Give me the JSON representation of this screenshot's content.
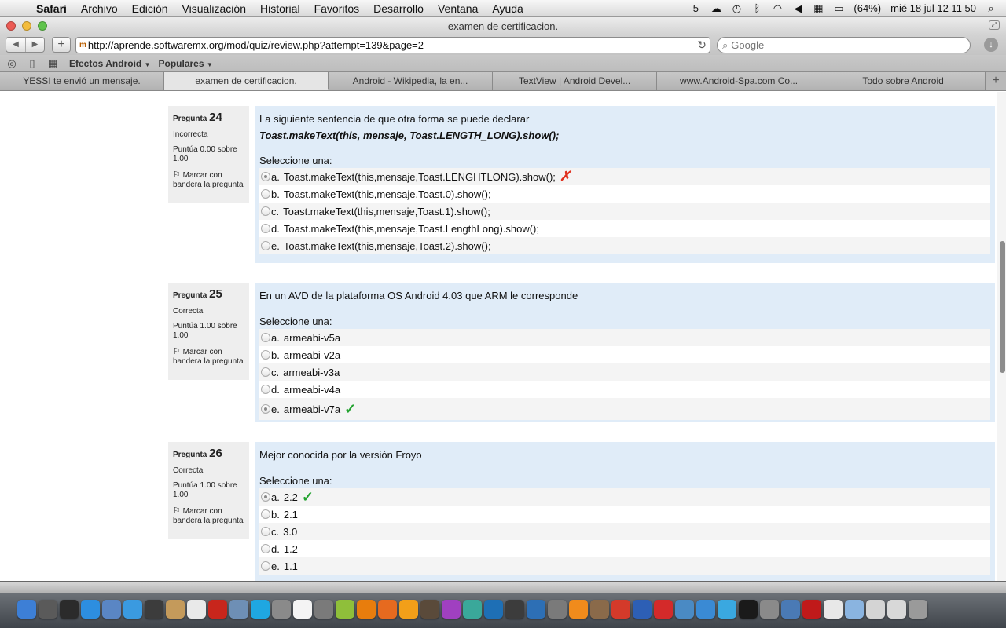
{
  "menubar": {
    "app": "Safari",
    "items": [
      "Archivo",
      "Edición",
      "Visualización",
      "Historial",
      "Favoritos",
      "Desarrollo",
      "Ventana",
      "Ayuda"
    ],
    "status_items": [
      "5"
    ],
    "battery": "(64%)",
    "clock": "mié 18 jul  12 11 50"
  },
  "window": {
    "title": "examen de certificacion."
  },
  "toolbar": {
    "favicon": "m",
    "url": "http://aprende.softwaremx.org/mod/quiz/review.php?attempt=139&page=2",
    "search_placeholder": "Google"
  },
  "bookmarks": {
    "items": [
      "Efectos Android",
      "Populares"
    ]
  },
  "tabs": [
    {
      "label": "YESSI te envió un mensaje."
    },
    {
      "label": "examen de certificacion."
    },
    {
      "label": "Android - Wikipedia, la en..."
    },
    {
      "label": "TextView | Android Devel..."
    },
    {
      "label": "www.Android-Spa.com Co..."
    },
    {
      "label": "Todo sobre Android"
    }
  ],
  "questions": [
    {
      "label": "Pregunta",
      "number": "24",
      "state": "Incorrecta",
      "grade": "Puntúa 0.00 sobre 1.00",
      "flag": "Marcar con bandera la pregunta",
      "text": "La siguiente sentencia de que otra forma se puede declarar",
      "code": "Toast.makeText(this, mensaje, Toast.LENGTH_LONG).show();",
      "prompt": "Seleccione una:",
      "answers": [
        {
          "letter": "a.",
          "text": "Toast.makeText(this,mensaje,Toast.LENGHTLONG).show();"
        },
        {
          "letter": "b.",
          "text": "Toast.makeText(this,mensaje,Toast.0).show();"
        },
        {
          "letter": "c.",
          "text": "Toast.makeText(this,mensaje,Toast.1).show();"
        },
        {
          "letter": "d.",
          "text": "Toast.makeText(this,mensaje,Toast.LengthLong).show();"
        },
        {
          "letter": "e.",
          "text": "Toast.makeText(this,mensaje,Toast.2).show();"
        }
      ],
      "selected": 0,
      "feedback": "wrong"
    },
    {
      "label": "Pregunta",
      "number": "25",
      "state": "Correcta",
      "grade": "Puntúa 1.00 sobre 1.00",
      "flag": "Marcar con bandera la pregunta",
      "text": "En un AVD de la plataforma OS Android 4.03 que ARM le corresponde",
      "prompt": "Seleccione una:",
      "answers": [
        {
          "letter": "a.",
          "text": "armeabi-v5a"
        },
        {
          "letter": "b.",
          "text": "armeabi-v2a"
        },
        {
          "letter": "c.",
          "text": "armeabi-v3a"
        },
        {
          "letter": "d.",
          "text": "armeabi-v4a"
        },
        {
          "letter": "e.",
          "text": "armeabi-v7a"
        }
      ],
      "selected": 4,
      "feedback": "right"
    },
    {
      "label": "Pregunta",
      "number": "26",
      "state": "Correcta",
      "grade": "Puntúa 1.00 sobre 1.00",
      "flag": "Marcar con bandera la pregunta",
      "text": "Mejor conocida por la versión Froyo",
      "prompt": "Seleccione una:",
      "answers": [
        {
          "letter": "a.",
          "text": "2.2"
        },
        {
          "letter": "b.",
          "text": "2.1"
        },
        {
          "letter": "c.",
          "text": "3.0"
        },
        {
          "letter": "d.",
          "text": "1.2"
        },
        {
          "letter": "e.",
          "text": "1.1"
        }
      ],
      "selected": 0,
      "feedback": "right"
    }
  ],
  "dock": {
    "apps": [
      {
        "name": "finder-icon",
        "color": "#3d7fd6"
      },
      {
        "name": "launchpad-icon",
        "color": "#5a5a5a"
      },
      {
        "name": "dashboard-icon",
        "color": "#2b2b2b"
      },
      {
        "name": "app-store-icon",
        "color": "#2d8ee0"
      },
      {
        "name": "preview-icon",
        "color": "#5a86c4"
      },
      {
        "name": "safari-icon",
        "color": "#3a9ae0"
      },
      {
        "name": "x11-icon",
        "color": "#3c3c3c"
      },
      {
        "name": "notes-icon",
        "color": "#c49a5b"
      },
      {
        "name": "calendar-icon",
        "color": "#e9e9e9"
      },
      {
        "name": "filezilla-icon",
        "color": "#c8261c"
      },
      {
        "name": "package-icon",
        "color": "#6e8fb5"
      },
      {
        "name": "skype-icon",
        "color": "#1fa7e1"
      },
      {
        "name": "utility-icon",
        "color": "#8a8a8a"
      },
      {
        "name": "document-icon",
        "color": "#f4f4f4"
      },
      {
        "name": "photo-icon",
        "color": "#7a7a7a"
      },
      {
        "name": "android-icon",
        "color": "#8fbf3a"
      },
      {
        "name": "blender-icon",
        "color": "#e87d0d"
      },
      {
        "name": "firefox-icon",
        "color": "#e66a1f"
      },
      {
        "name": "illustrator-icon",
        "color": "#f29f19"
      },
      {
        "name": "user-icon",
        "color": "#5a4a3a"
      },
      {
        "name": "sphere-icon",
        "color": "#a040c0"
      },
      {
        "name": "gear-icon",
        "color": "#3aa89a"
      },
      {
        "name": "photoshop-icon",
        "color": "#1e6fb5"
      },
      {
        "name": "unity-icon",
        "color": "#3c3c3c"
      },
      {
        "name": "virtualbox-icon",
        "color": "#2d6fb5"
      },
      {
        "name": "wolf-icon",
        "color": "#7a7a7a"
      },
      {
        "name": "vlc-icon",
        "color": "#f08b1c"
      },
      {
        "name": "gimp-icon",
        "color": "#8a6a4a"
      },
      {
        "name": "angry-birds-icon",
        "color": "#d43a2a"
      },
      {
        "name": "globe-icon",
        "color": "#2d5fb5"
      },
      {
        "name": "star-icon",
        "color": "#d42a2a"
      },
      {
        "name": "chart-icon",
        "color": "#4a8ac4"
      },
      {
        "name": "itunes-icon",
        "color": "#3a8ad4"
      },
      {
        "name": "twitter-icon",
        "color": "#3aa8e0"
      },
      {
        "name": "terminal-icon",
        "color": "#1a1a1a"
      },
      {
        "name": "settings-icon",
        "color": "#8a8a8a"
      },
      {
        "name": "pen-icon",
        "color": "#4a7ab5"
      },
      {
        "name": "flash-icon",
        "color": "#c01a1a"
      },
      {
        "name": "file-icon",
        "color": "#e8e8e8"
      },
      {
        "name": "folder-icon",
        "color": "#8ab4e0"
      },
      {
        "name": "mail-icon",
        "color": "#d4d4d4"
      },
      {
        "name": "downloads-icon",
        "color": "#d8d8d8"
      },
      {
        "name": "trash-icon",
        "color": "#9a9a9a"
      }
    ]
  }
}
